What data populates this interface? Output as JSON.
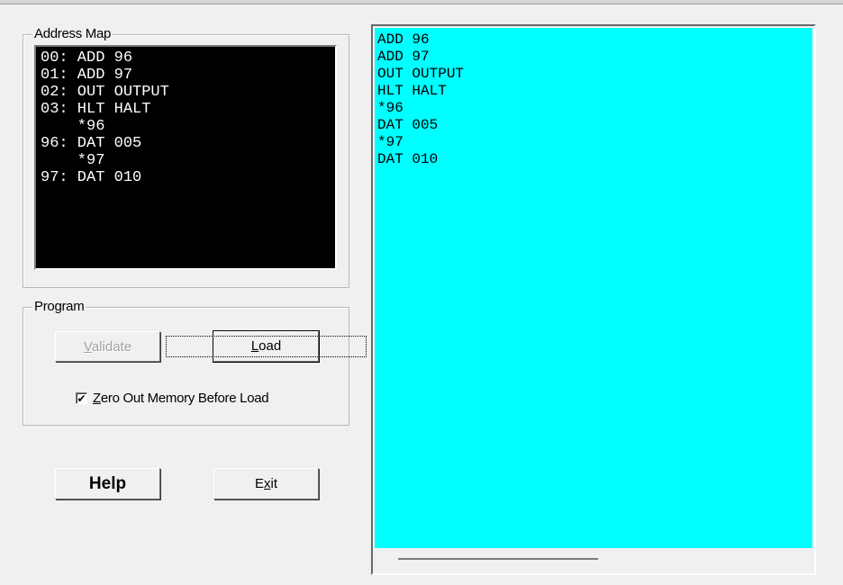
{
  "address_map": {
    "title": "Address Map",
    "lines": [
      "00: ADD 96",
      "01: ADD 97",
      "02: OUT OUTPUT",
      "03: HLT HALT",
      "    *96",
      "96: DAT 005",
      "    *97",
      "97: DAT 010"
    ],
    "background": "#000000",
    "text_color": "#ffffff"
  },
  "program": {
    "title": "Program",
    "validate_label": "Validate",
    "validate_accel": "V",
    "load_label": "Load",
    "load_accel": "L",
    "zero_memory": {
      "label_prefix": "",
      "accel": "Z",
      "label_rest": "ero Out Memory Before Load",
      "checked": true
    }
  },
  "buttons": {
    "help_label": "Help",
    "exit_prefix": "E",
    "exit_accel": "x",
    "exit_rest": "it"
  },
  "editor": {
    "background": "#00ffff",
    "text": "ADD 96\nADD 97\nOUT OUTPUT\nHLT HALT\n*96\nDAT 005\n*97\nDAT 010"
  },
  "icons": {
    "checkmark": "check-icon"
  }
}
